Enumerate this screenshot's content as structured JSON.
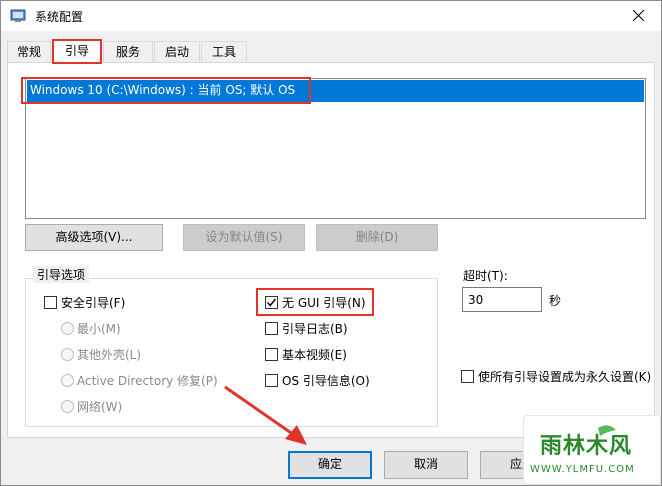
{
  "window": {
    "title": "系统配置",
    "accent": "#0078d7",
    "highlight_color": "#e0352b"
  },
  "tabs": [
    {
      "label": "常规",
      "active": false
    },
    {
      "label": "引导",
      "active": true
    },
    {
      "label": "服务",
      "active": false
    },
    {
      "label": "启动",
      "active": false
    },
    {
      "label": "工具",
      "active": false
    }
  ],
  "boot": {
    "os_entries": [
      "Windows 10 (C:\\Windows) : 当前 OS; 默认 OS"
    ],
    "advanced_button": "高级选项(V)...",
    "set_default_button": "设为默认值(S)",
    "delete_button": "删除(D)"
  },
  "boot_options": {
    "label": "引导选项",
    "safe_boot": {
      "label": "安全引导(F)",
      "checked": false
    },
    "radios": [
      "最小(M)",
      "其他外壳(L)",
      "Active Directory 修复(P)",
      "网络(W)"
    ],
    "no_gui": {
      "label": "无 GUI 引导(N)",
      "checked": true
    },
    "boot_log": {
      "label": "引导日志(B)",
      "checked": false
    },
    "base_video": {
      "label": "基本视频(E)",
      "checked": false
    },
    "os_boot_info": {
      "label": "OS 引导信息(O)",
      "checked": false
    }
  },
  "timeout": {
    "label": "超时(T):",
    "value": "30",
    "unit": "秒"
  },
  "permanent": {
    "label": "使所有引导设置成为永久设置(K)",
    "checked": false
  },
  "footer": {
    "ok_button": "确定",
    "cancel_button": "取消",
    "apply_button_partial": "应用"
  },
  "watermark": {
    "text": "雨林木风",
    "url": "WWW.YLMFU.COM"
  },
  "icons": {
    "app": "msconfig-icon",
    "close": "close-icon",
    "check": "checkmark-icon"
  }
}
